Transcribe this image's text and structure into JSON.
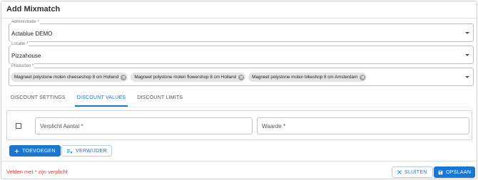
{
  "dialog": {
    "title": "Add Mixmatch"
  },
  "fields": {
    "administratie": {
      "label": "Administratie *",
      "value": "Actablue DEMO"
    },
    "locatie": {
      "label": "Locatie *",
      "value": "Pizzahouse"
    },
    "producten": {
      "label": "Producten *",
      "chips": [
        "Magneet polystone molen cheeseshop 8 cm Holland",
        "Magneet polystone molen flowershop 8 cm Holland",
        "Magneet polystone molen bikeshop 8 cm Amsterdam"
      ]
    }
  },
  "tabs": [
    {
      "label": "DISCOUNT SETTINGS",
      "active": false
    },
    {
      "label": "DISCOUNT VALUES",
      "active": true
    },
    {
      "label": "DISCOUNT LIMITS",
      "active": false
    }
  ],
  "discount_values": {
    "verplicht_aantal_placeholder": "Verplicht Aantal *",
    "waarde_placeholder": "Waarde *"
  },
  "actions": {
    "add_label": "TOEVOEGEN",
    "remove_label": "VERWIJDER"
  },
  "footer": {
    "required_note": "Velden met * zijn verplicht",
    "close_label": "SLUITEN",
    "save_label": "OPSLAAN"
  },
  "colors": {
    "primary": "#1976d2",
    "error": "#e53935",
    "chip_bg": "#e4e4e4"
  },
  "icons": [
    "caret-down-icon",
    "chip-remove-icon",
    "plus-icon",
    "playlist-remove-icon",
    "close-icon",
    "save-icon"
  ]
}
